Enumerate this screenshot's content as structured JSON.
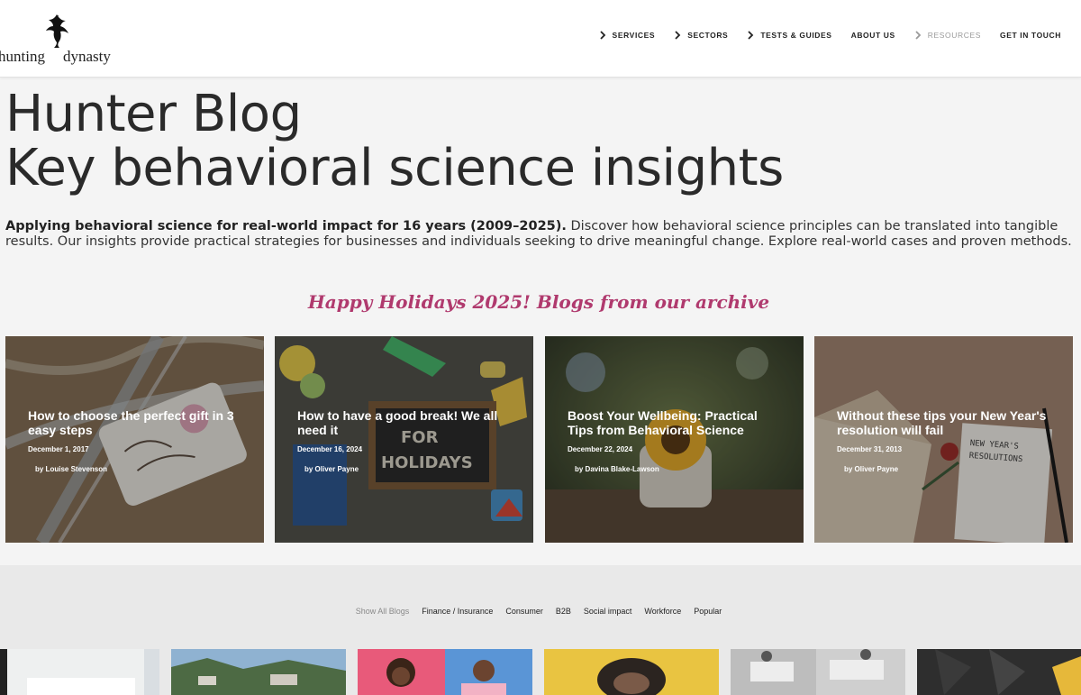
{
  "brand": {
    "logo_left": "hunting",
    "logo_right": "dynasty"
  },
  "nav": [
    {
      "label": "SERVICES",
      "chevron": true
    },
    {
      "label": "SECTORS",
      "chevron": true
    },
    {
      "label": "TESTS & GUIDES",
      "chevron": true
    },
    {
      "label": "ABOUT US",
      "chevron": false
    },
    {
      "label": "RESOURCES",
      "chevron": true,
      "muted": true
    },
    {
      "label": "GET IN TOUCH",
      "chevron": false
    }
  ],
  "hero": {
    "line1": "Hunter Blog",
    "line2": "Key behavioral science insights",
    "intro_bold": "Applying behavioral science for real-world impact for 16 years (2009–2025).",
    "intro_rest": " Discover how behavioral science principles can be translated into tangible results. Our insights provide practical strategies for businesses and individuals seeking to drive meaningful change. Explore real-world cases and proven methods."
  },
  "featured": {
    "heading": "Happy Holidays 2025! Blogs from our archive",
    "cards": [
      {
        "title": "How to choose the perfect gift in 3 easy steps",
        "date": "December 1, 2017",
        "author": "by Louise Stevenson"
      },
      {
        "title": "How to have a good break! We all need it",
        "date": "December 16, 2024",
        "author": "by Oliver Payne"
      },
      {
        "title": "Boost Your Wellbeing: Practical Tips from Behavioral Science",
        "date": "December 22, 2024",
        "author": "by Davina Blake-Lawson"
      },
      {
        "title": "Without these tips your New Year's resolution will fail",
        "date": "December 31, 2013",
        "author": "by Oliver Payne"
      }
    ]
  },
  "filters": [
    "Show All Blogs",
    "Finance / Insurance",
    "Consumer",
    "B2B",
    "Social impact",
    "Workforce",
    "Popular"
  ],
  "colors": {
    "accent": "#b03a6e",
    "header_bg": "#ffffff",
    "page_bg": "#f4f4f4",
    "filter_band_bg": "#e9e9e9"
  }
}
